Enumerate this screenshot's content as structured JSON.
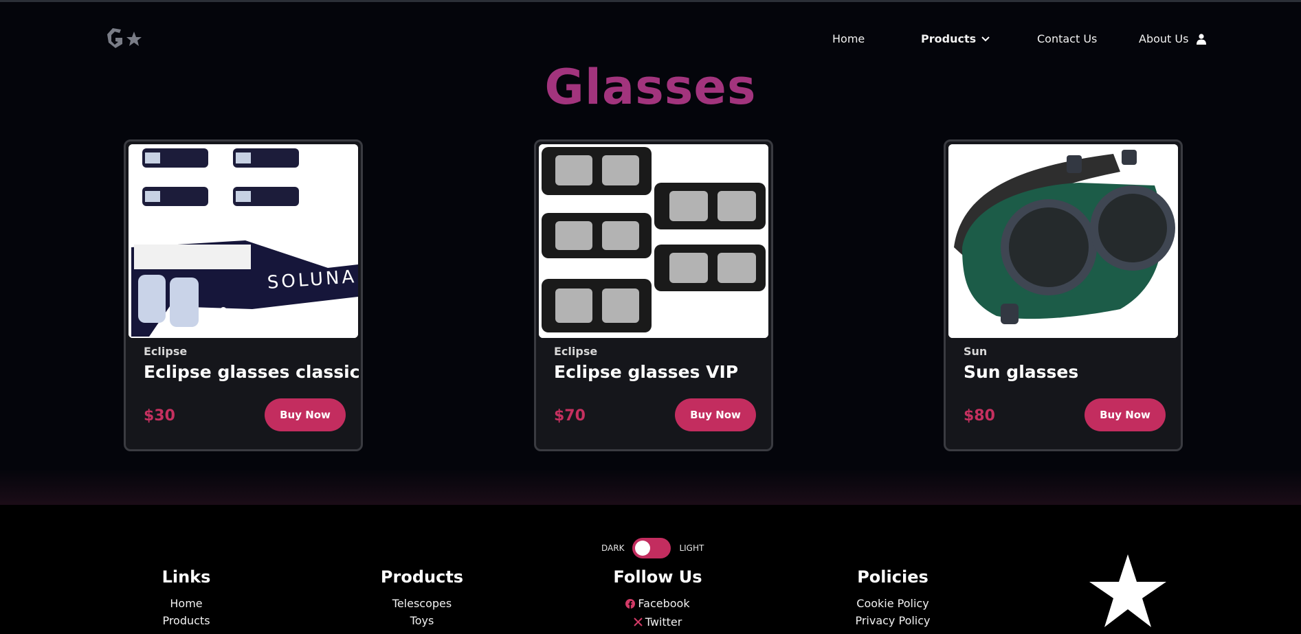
{
  "header": {
    "logo_icon": "g-star-logo-icon",
    "nav": {
      "home": "Home",
      "products": "Products",
      "contact": "Contact Us",
      "about": "About Us"
    }
  },
  "page": {
    "title": "Glasses"
  },
  "products": [
    {
      "category": "Eclipse",
      "name": "Eclipse glasses classic",
      "price": "$30",
      "button": "Buy Now",
      "image": "eclipse-glasses-classic-image",
      "watermark": "SOLUNA"
    },
    {
      "category": "Eclipse",
      "name": "Eclipse glasses VIP",
      "price": "$70",
      "button": "Buy Now",
      "image": "eclipse-glasses-vip-image"
    },
    {
      "category": "Sun",
      "name": "Sun glasses",
      "price": "$80",
      "button": "Buy Now",
      "image": "welding-goggles-image"
    }
  ],
  "footer": {
    "theme": {
      "dark": "DARK",
      "light": "LIGHT",
      "state": "dark"
    },
    "links": {
      "title": "Links",
      "items": [
        "Home",
        "Products"
      ]
    },
    "products": {
      "title": "Products",
      "items": [
        "Telescopes",
        "Toys"
      ]
    },
    "follow": {
      "title": "Follow Us",
      "items": [
        "Facebook",
        "Twitter"
      ]
    },
    "policies": {
      "title": "Policies",
      "items": [
        "Cookie Policy",
        "Privacy Policy"
      ]
    }
  },
  "colors": {
    "accent": "#c32d5f",
    "title": "#a2347d",
    "background": "#04050b",
    "card": "#15161b"
  }
}
